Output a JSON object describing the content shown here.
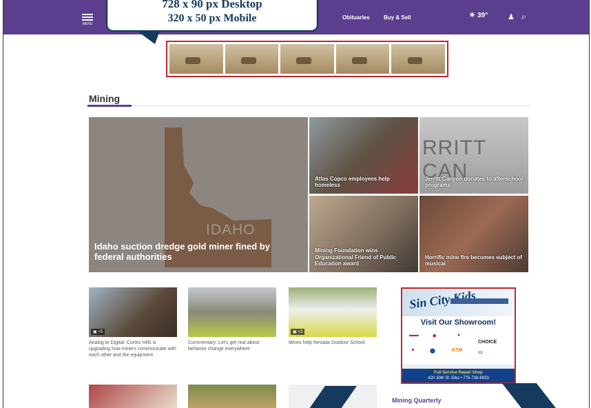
{
  "callout_top": {
    "line1": "728 x 90 px Desktop",
    "line2": "320 x 50 px Mobile"
  },
  "nav": {
    "menu_label": "MENU",
    "items": [
      "Obituaries",
      "Buy & Sell"
    ],
    "weather_temp": "39°"
  },
  "section": {
    "title": "Mining"
  },
  "hero": {
    "main_caption": "Idaho suction dredge gold miner fined by federal authorities",
    "main_map_label": "IDAHO",
    "tiles": [
      {
        "caption": "Atlas Copco employees help homeless"
      },
      {
        "caption": "Jerritt Canyon donates to afterschool programs",
        "overlay_text": "RRITT CAN"
      },
      {
        "caption": "Mining Foundation wins Organizational Friend of Public Education award"
      },
      {
        "caption": "Horrific mine fire becomes subject of musical"
      }
    ]
  },
  "articles": [
    {
      "title": "Analog to Digital: Cortez Hills is upgrading how miners communicate with each other and the equipment",
      "badge": "+5"
    },
    {
      "title": "Commentary: Let's get real about behavior change everywhere",
      "badge": ""
    },
    {
      "title": "Mines help Nevada Outdoor School",
      "badge": "+3"
    }
  ],
  "ad": {
    "logo_text": "Sin City Kids",
    "showroom": "Visit Our Showroom!",
    "service": "Full Service Repair Shop",
    "address": "420 30th St. Elko • 775-738-8933"
  },
  "sidebar_heading": "Mining Quarterly"
}
